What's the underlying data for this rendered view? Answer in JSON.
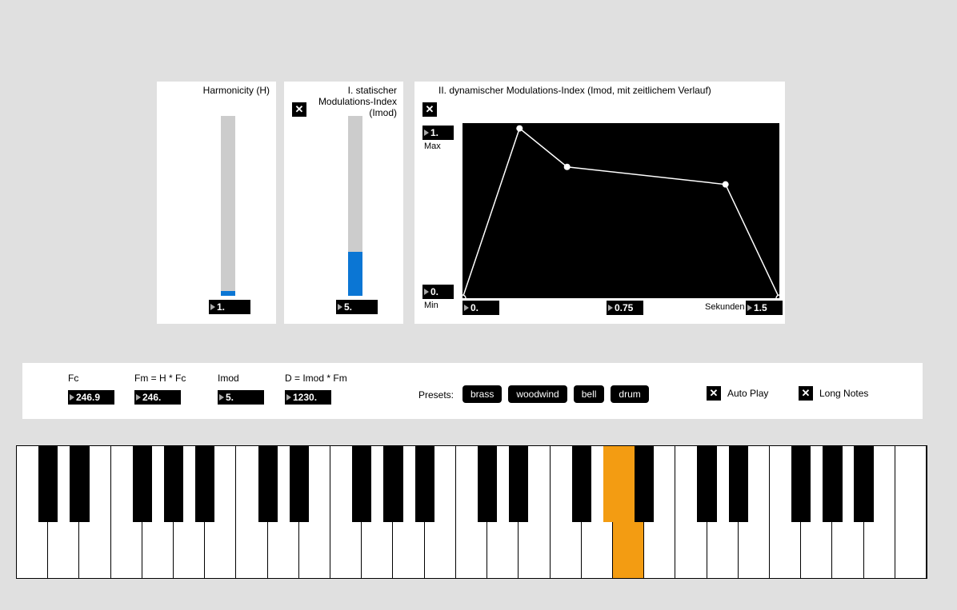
{
  "harmonicity": {
    "title": "Harmonicity (H)",
    "value": "1."
  },
  "imod_static": {
    "title": "I. statischer Modulations-Index (Imod)",
    "value": "5."
  },
  "envelope": {
    "title": "II. dynamischer Modulations-Index (Imod, mit zeitlichem Verlauf)",
    "y_max": "1.",
    "y_max_label": "Max",
    "y_min": "0.",
    "y_min_label": "Min",
    "x_start": "0.",
    "x_mid": "0.75",
    "x_end": "1.5",
    "seconds_label": "Sekunden",
    "points": [
      {
        "x": 0.0,
        "y": 0.0
      },
      {
        "x": 0.18,
        "y": 0.97
      },
      {
        "x": 0.33,
        "y": 0.75
      },
      {
        "x": 0.83,
        "y": 0.65
      },
      {
        "x": 1.0,
        "y": 0.0
      }
    ]
  },
  "params": {
    "fc": {
      "label": "Fc",
      "value": "246.9"
    },
    "fm": {
      "label": "Fm = H * Fc",
      "value": "246."
    },
    "imod": {
      "label": "Imod",
      "value": "5."
    },
    "d": {
      "label": "D = Imod * Fm",
      "value": "1230."
    }
  },
  "presets": {
    "label": "Presets:",
    "items": [
      "brass",
      "woodwind",
      "bell",
      "drum"
    ]
  },
  "options": {
    "autoplay": "Auto Play",
    "longnotes": "Long Notes"
  },
  "keyboard": {
    "white_keys": 29,
    "active_white_index": 19,
    "active_black_over_white": 19
  }
}
